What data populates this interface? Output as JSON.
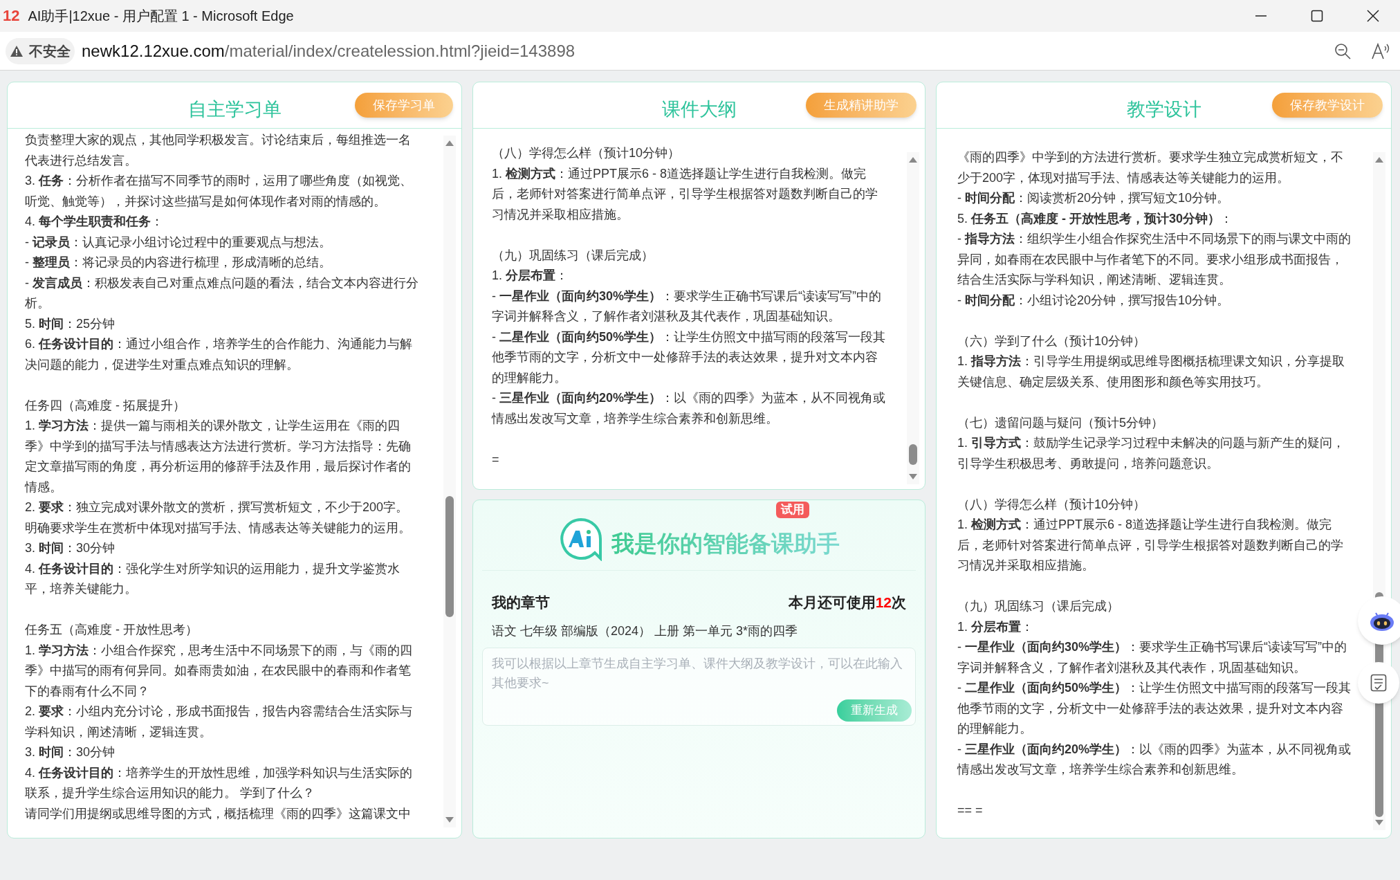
{
  "window": {
    "logo_text": "12",
    "title": "AI助手|12xue - 用户配置 1 - Microsoft Edge"
  },
  "address_bar": {
    "security": "不安全",
    "url_host": "newk12.12xue.com",
    "url_path": "/material/index/createlession.html?jieid=143898"
  },
  "panels": [
    {
      "title": "自主学习单",
      "button": "保存学习单",
      "sections": [
        [
          "负责整理大家的观点，其他同学积极发言。讨论结束后，每组推选一名代表进行总结发言。",
          "3. **任务**：分析作者在描写不同季节的雨时，运用了哪些角度（如视觉、听觉、触觉等），并探讨这些描写是如何体现作者对雨的情感的。",
          "4. **每个学生职责和任务**：",
          "- **记录员**：认真记录小组讨论过程中的重要观点与想法。",
          "- **整理员**：将记录员的内容进行梳理，形成清晰的总结。",
          "- **发言成员**：积极发表自己对重点难点问题的看法，结合文本内容进行分析。",
          "5. **时间**：25分钟",
          "6. **任务设计目的**：通过小组合作，培养学生的合作能力、沟通能力与解决问题的能力，促进学生对重点难点知识的理解。"
        ],
        [
          "任务四（高难度 - 拓展提升）",
          "1. **学习方法**：提供一篇与雨相关的课外散文，让学生运用在《雨的四季》中学到的描写手法与情感表达方法进行赏析。学习方法指导：先确定文章描写雨的角度，再分析运用的修辞手法及作用，最后探讨作者的情感。",
          "2. **要求**：独立完成对课外散文的赏析，撰写赏析短文，不少于200字。明确要求学生在赏析中体现对描写手法、情感表达等关键能力的运用。",
          "3. **时间**：30分钟",
          "4. **任务设计目的**：强化学生对所学知识的运用能力，提升文学鉴赏水平，培养关键能力。"
        ],
        [
          "任务五（高难度 - 开放性思考）",
          "1. **学习方法**：小组合作探究，思考生活中不同场景下的雨，与《雨的四季》中描写的雨有何异同。如春雨贵如油，在农民眼中的春雨和作者笔下的春雨有什么不同？",
          "2. **要求**：小组内充分讨论，形成书面报告，报告内容需结合生活实际与学科知识，阐述清晰，逻辑连贯。",
          "3. **时间**：30分钟",
          "4. **任务设计目的**：培养学生的开放性思维，加强学科知识与生活实际的联系，提升学生综合运用知识的能力。 学到了什么？",
          "请同学们用提纲或思维导图的方式，概括梳理《雨的四季》这篇课文中"
        ]
      ]
    },
    {
      "title": "课件大纲",
      "button": "生成精讲助学",
      "sections": [
        [
          "（八）学得怎么样（预计10分钟）",
          "1. **检测方式**：通过PPT展示6 - 8道选择题让学生进行自我检测。做完后，老师针对答案进行简单点评，引导学生根据答对题数判断自己的学习情况并采取相应措施。"
        ],
        [
          "（九）巩固练习（课后完成）",
          "1. **分层布置**：",
          "- **一星作业（面向约30%学生）**：要求学生正确书写课后“读读写写”中的字词并解释含义，了解作者刘湛秋及其代表作，巩固基础知识。",
          "- **二星作业（面向约50%学生）**：让学生仿照文中描写雨的段落写一段其他季节雨的文字，分析文中一处修辞手法的表达效果，提升对文本内容的理解能力。",
          "- **三星作业（面向约20%学生）**：以《雨的四季》为蓝本，从不同视角或情感出发改写文章，培养学生综合素养和创新思维。"
        ],
        [
          "="
        ]
      ]
    },
    {
      "title": "教学设计",
      "button": "保存教学设计",
      "sections": [
        [
          "《雨的四季》中学到的方法进行赏析。要求学生独立完成赏析短文，不少于200字，体现对描写手法、情感表达等关键能力的运用。",
          "- **时间分配**：阅读赏析20分钟，撰写短文10分钟。",
          "5. **任务五（高难度 - 开放性思考，预计30分钟）**：",
          "- **指导方法**：组织学生小组合作探究生活中不同场景下的雨与课文中雨的异同，如春雨在农民眼中与作者笔下的不同。要求小组形成书面报告，结合生活实际与学科知识，阐述清晰、逻辑连贯。",
          "- **时间分配**：小组讨论20分钟，撰写报告10分钟。"
        ],
        [
          "（六）学到了什么（预计10分钟）",
          "1. **指导方法**：引导学生用提纲或思维导图概括梳理课文知识，分享提取关键信息、确定层级关系、使用图形和颜色等实用技巧。"
        ],
        [
          "（七）遗留问题与疑问（预计5分钟）",
          "1. **引导方式**：鼓励学生记录学习过程中未解决的问题与新产生的疑问，引导学生积极思考、勇敢提问，培养问题意识。"
        ],
        [
          "（八）学得怎么样（预计10分钟）",
          "1. **检测方式**：通过PPT展示6 - 8道选择题让学生进行自我检测。做完后，老师针对答案进行简单点评，引导学生根据答对题数判断自己的学习情况并采取相应措施。"
        ],
        [
          "（九）巩固练习（课后完成）",
          "1. **分层布置**：",
          "- **一星作业（面向约30%学生）**：要求学生正确书写课后“读读写写”中的字词并解释含义，了解作者刘湛秋及其代表作，巩固基础知识。",
          "- **二星作业（面向约50%学生）**：让学生仿照文中描写雨的段落写一段其他季节雨的文字，分析文中一处修辞手法的表达效果，提升对文本内容的理解能力。",
          "- **三星作业（面向约20%学生）**：以《雨的四季》为蓝本，从不同视角或情感出发改写文章，培养学生综合素养和创新思维。"
        ],
        [
          "== ="
        ]
      ]
    }
  ],
  "assistant": {
    "badge": "试用",
    "title": "我是你的智能备课助手",
    "chapter_label": "我的章节",
    "quota_prefix": "本月还可使用",
    "quota_count": "12",
    "quota_suffix": "次",
    "chapter": "语文 七年级 部编版（2024） 上册 第一单元 3*雨的四季",
    "placeholder": "我可以根据以上章节生成自主学习单、课件大纲及教学设计，可以在此输入其他要求~",
    "button": "重新生成"
  }
}
